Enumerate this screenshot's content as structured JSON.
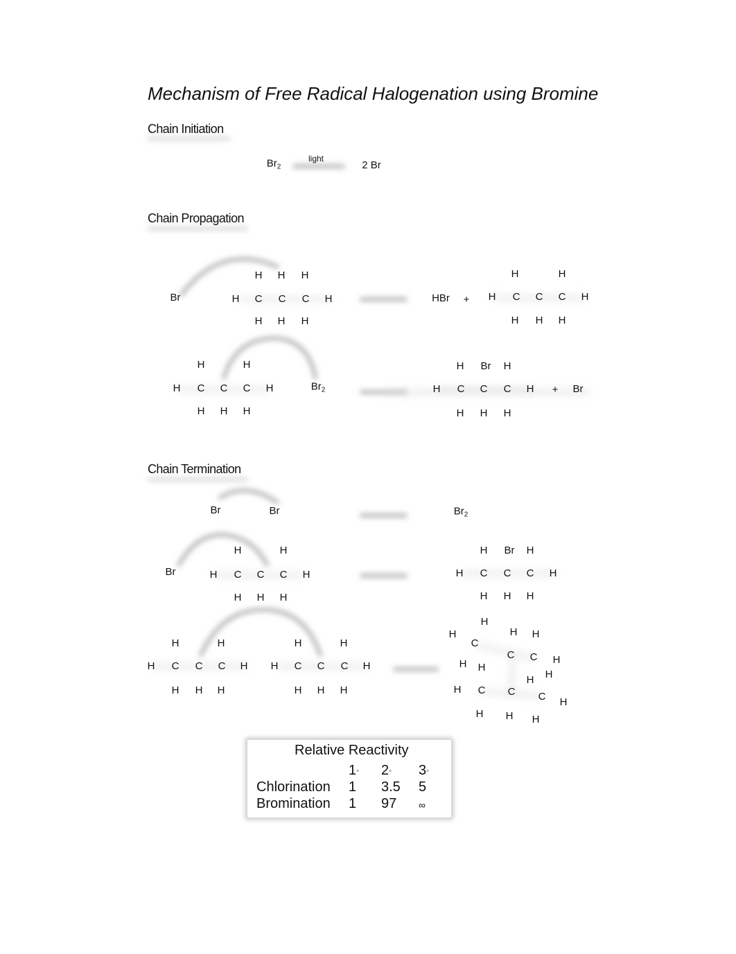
{
  "document": {
    "title": "Mechanism of Free Radical Halogenation using Bromine",
    "sections": {
      "initiation": "Chain Initiation",
      "propagation": "Chain Propagation",
      "termination": "Chain Termination"
    }
  },
  "initiation": {
    "reactant": "Br",
    "reactant_subscript": "2",
    "arrow_label": "light",
    "product": "2 Br"
  },
  "propagation": {
    "step1": {
      "radical": "Br",
      "molecule_name": "propane",
      "product1": "HBr",
      "plus": "+",
      "product2_name": "2-propyl radical"
    },
    "step2": {
      "reactant_name": "2-propyl radical",
      "reagent": "Br",
      "reagent_subscript": "2",
      "product1_name": "2-bromopropane",
      "plus": "+",
      "product2": "Br"
    }
  },
  "termination": {
    "step1": {
      "left": "Br",
      "right": "Br",
      "product": "Br",
      "product_subscript": "2"
    },
    "step2": {
      "radical": "Br",
      "radical2_name": "2-propyl radical",
      "product_name": "2-bromopropane"
    },
    "step3": {
      "reactant_name": "2-propyl radical (x2)",
      "product_name": "2,3-dimethylbutane"
    }
  },
  "atoms": {
    "H": "H",
    "C": "C",
    "Br": "Br"
  },
  "reactivity_table": {
    "title": "Relative Reactivity",
    "columns": [
      "1",
      "2",
      "3"
    ],
    "degree_symbol": "◦",
    "rows": [
      {
        "label": "Chlorination",
        "values": [
          "1",
          "3.5",
          "5"
        ]
      },
      {
        "label": "Bromination",
        "values": [
          "1",
          "97",
          "∞"
        ]
      }
    ]
  }
}
